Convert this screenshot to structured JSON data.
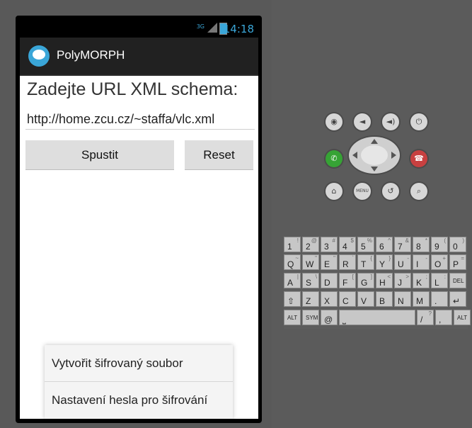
{
  "status": {
    "net": "3G",
    "time": "14:18"
  },
  "app": {
    "title": "PolyMORPH"
  },
  "main": {
    "prompt": "Zadejte URL XML schema:",
    "url_value": "http://home.zcu.cz/~staffa/vlc.xml",
    "spustit_label": "Spustit",
    "reset_label": "Reset"
  },
  "menu": {
    "items": [
      {
        "label": "Vytvořit šifrovaný soubor"
      },
      {
        "label": "Nastavení hesla pro šifrování"
      }
    ]
  },
  "controls": {
    "menu_label": "MENU"
  },
  "keyboard": {
    "rows": [
      [
        {
          "k": "1",
          "a": "!"
        },
        {
          "k": "2",
          "a": "@"
        },
        {
          "k": "3",
          "a": "#"
        },
        {
          "k": "4",
          "a": "$"
        },
        {
          "k": "5",
          "a": "%"
        },
        {
          "k": "6",
          "a": "^"
        },
        {
          "k": "7",
          "a": "&"
        },
        {
          "k": "8",
          "a": "*"
        },
        {
          "k": "9",
          "a": "("
        },
        {
          "k": "0",
          "a": ")"
        }
      ],
      [
        {
          "k": "Q",
          "a": "~"
        },
        {
          "k": "W",
          "a": "\""
        },
        {
          "k": "E",
          "a": "\""
        },
        {
          "k": "R",
          "a": "`"
        },
        {
          "k": "T",
          "a": "{"
        },
        {
          "k": "Y",
          "a": "}"
        },
        {
          "k": "U",
          "a": "-"
        },
        {
          "k": "I",
          "a": "-"
        },
        {
          "k": "O",
          "a": "+"
        },
        {
          "k": "P",
          "a": "="
        }
      ],
      [
        {
          "k": "A",
          "a": "|"
        },
        {
          "k": "S",
          "a": "\\"
        },
        {
          "k": "D",
          "a": ""
        },
        {
          "k": "F",
          "a": "["
        },
        {
          "k": "G",
          "a": "]"
        },
        {
          "k": "H",
          "a": "<"
        },
        {
          "k": "J",
          "a": ">"
        },
        {
          "k": "K",
          "a": ";"
        },
        {
          "k": "L",
          "a": ":"
        },
        {
          "k": "DEL",
          "a": ""
        }
      ],
      [
        {
          "k": "⇧",
          "a": ""
        },
        {
          "k": "Z",
          "a": ""
        },
        {
          "k": "X",
          "a": ""
        },
        {
          "k": "C",
          "a": ""
        },
        {
          "k": "V",
          "a": ""
        },
        {
          "k": "B",
          "a": ""
        },
        {
          "k": "N",
          "a": ""
        },
        {
          "k": "M",
          "a": ""
        },
        {
          "k": ".",
          "a": ""
        },
        {
          "k": "↵",
          "a": ""
        }
      ],
      [
        {
          "k": "ALT",
          "a": ""
        },
        {
          "k": "SYM",
          "a": ""
        },
        {
          "k": "@",
          "a": ""
        },
        {
          "k": "␣",
          "a": ""
        },
        {
          "k": "/",
          "a": "?"
        },
        {
          "k": ",",
          "a": ""
        },
        {
          "k": "ALT",
          "a": ""
        }
      ]
    ]
  }
}
